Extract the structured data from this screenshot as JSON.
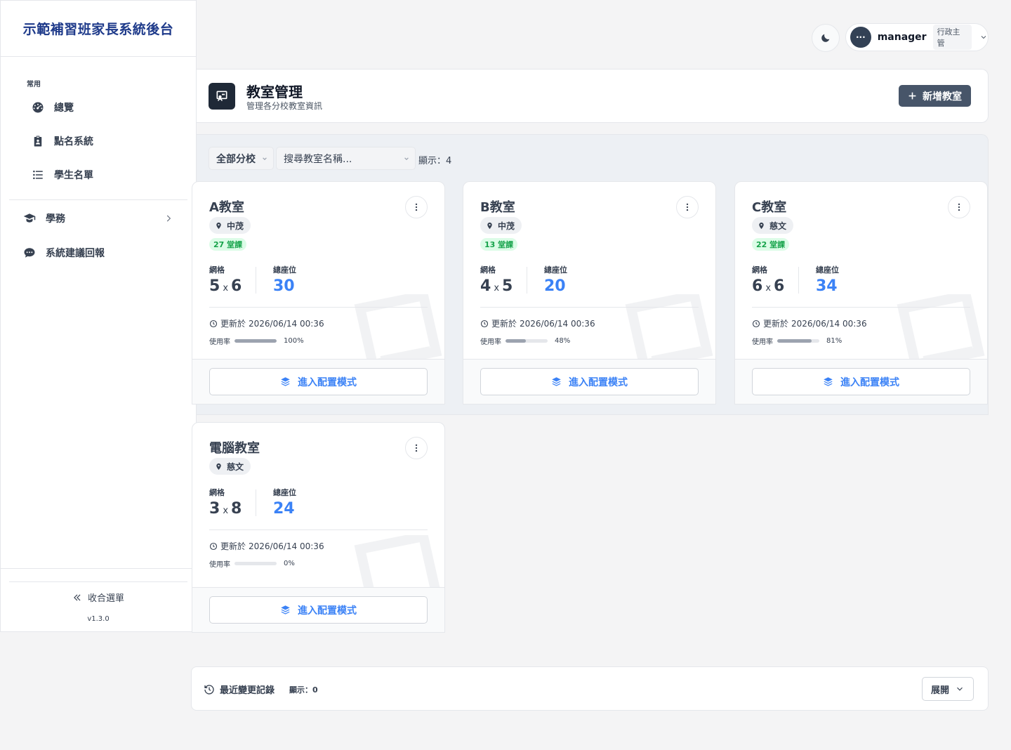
{
  "app": {
    "title": "示範補習班家長系統後台",
    "version": "v1.3.0"
  },
  "sidebar": {
    "section_label": "常用",
    "items": [
      {
        "label": "總覽",
        "icon": "dashboard-icon"
      },
      {
        "label": "點名系統",
        "icon": "clipboard-icon"
      },
      {
        "label": "學生名單",
        "icon": "list-icon"
      }
    ],
    "groups": [
      {
        "label": "學務",
        "icon": "graduation-icon"
      },
      {
        "label": "系統建議回報",
        "icon": "chat-icon"
      }
    ],
    "collapse_label": "收合選單"
  },
  "topbar": {
    "avatar_text": "···",
    "user_name": "manager",
    "role": "行政主管"
  },
  "header": {
    "title": "教室管理",
    "subtitle": "管理各分校教室資訊",
    "add_button": "新增教室"
  },
  "filters": {
    "branch_select": "全部分校",
    "search_placeholder": "搜尋教室名稱...",
    "count_text": "顯示：4"
  },
  "labels": {
    "grid": "網格",
    "seats": "總座位",
    "updated_prefix": "更新於",
    "usage": "使用率",
    "config_button": "進入配置模式",
    "times": "x"
  },
  "rooms": [
    {
      "name": "A教室",
      "branch": "中茂",
      "lessons": "27 堂課",
      "rows": "5",
      "cols": "6",
      "seats": "30",
      "updated": "2026/06/14 00:36",
      "usage_text": "100%",
      "usage": 100
    },
    {
      "name": "B教室",
      "branch": "中茂",
      "lessons": "13 堂課",
      "rows": "4",
      "cols": "5",
      "seats": "20",
      "updated": "2026/06/14 00:36",
      "usage_text": "48%",
      "usage": 48
    },
    {
      "name": "C教室",
      "branch": "慈文",
      "lessons": "22 堂課",
      "rows": "6",
      "cols": "6",
      "seats": "34",
      "updated": "2026/06/14 00:36",
      "usage_text": "81%",
      "usage": 81
    },
    {
      "name": "電腦教室",
      "branch": "慈文",
      "lessons": "",
      "rows": "3",
      "cols": "8",
      "seats": "24",
      "updated": "2026/06/14 00:36",
      "usage_text": "0%",
      "usage": 0
    }
  ],
  "changelog": {
    "title": "最近變更記錄",
    "count_text": "顯示：0",
    "expand_button": "展開"
  },
  "colors": {
    "accent": "#3b82f6",
    "primary_button": "#475569",
    "lesson_badge": "#16a34a"
  }
}
